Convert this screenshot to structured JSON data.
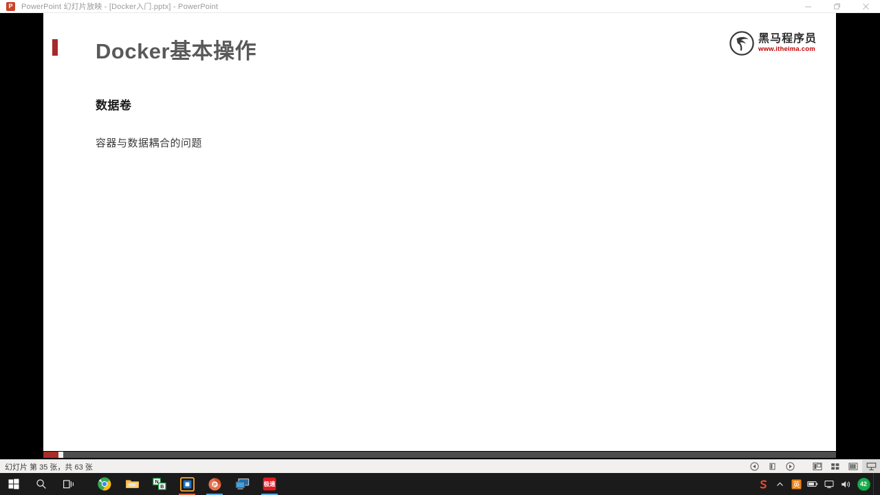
{
  "window": {
    "app_icon": "powerpoint-icon",
    "icon_letter": "P",
    "title": "PowerPoint 幻灯片放映 - [Docker入门.pptx] - PowerPoint",
    "controls": {
      "minimize": "minimize-icon",
      "restore": "restore-icon",
      "close": "close-icon"
    }
  },
  "slide": {
    "title": "Docker基本操作",
    "accent_color": "#a52a2a",
    "title_color": "#595959",
    "body": {
      "heading": "数据卷",
      "line": "容器与数据耦合的问题"
    },
    "logo": {
      "name_cn": "黑马程序员",
      "url": "www.itheima.com",
      "url_color": "#c00000"
    }
  },
  "progress": {
    "percent": 2,
    "fill_color": "#a82c28",
    "track_color": "#4d4d4d"
  },
  "statusbar": {
    "text": "幻灯片 第 35 张，共 63 张",
    "buttons": [
      {
        "name": "previous-slide-button",
        "label": "上一张"
      },
      {
        "name": "pause-button",
        "label": "暂停"
      },
      {
        "name": "next-slide-button",
        "label": "下一张"
      },
      {
        "name": "normal-view-button",
        "label": "普通视图"
      },
      {
        "name": "slide-sorter-button",
        "label": "幻灯片浏览"
      },
      {
        "name": "reading-view-button",
        "label": "阅读视图"
      },
      {
        "name": "slideshow-button",
        "label": "幻灯片放映"
      }
    ],
    "active_view": "slideshow-button"
  },
  "taskbar": {
    "items": [
      {
        "name": "start-button",
        "label": "开始"
      },
      {
        "name": "search-button",
        "label": "搜索"
      },
      {
        "name": "task-view-button",
        "label": "任务视图"
      },
      {
        "name": "chrome-taskbar-icon",
        "label": "Google Chrome"
      },
      {
        "name": "file-explorer-taskbar-icon",
        "label": "文件资源管理器"
      },
      {
        "name": "nb-app-taskbar-icon",
        "label": "NB"
      },
      {
        "name": "vmware-taskbar-icon",
        "label": "VMware"
      },
      {
        "name": "powerpoint-taskbar-icon",
        "label": "PowerPoint"
      },
      {
        "name": "remote-desktop-taskbar-icon",
        "label": "远程桌面"
      },
      {
        "name": "red-app-taskbar-icon",
        "label": "极速"
      }
    ],
    "red_icon_text": "极速",
    "tray": [
      {
        "name": "sogou-input-tray-icon",
        "label": "S"
      },
      {
        "name": "show-hidden-icons-chevron-icon",
        "label": "︿"
      },
      {
        "name": "ime-tray-icon",
        "label": "英"
      },
      {
        "name": "battery-tray-icon",
        "label": "电池"
      },
      {
        "name": "network-tray-icon",
        "label": "网络"
      },
      {
        "name": "volume-tray-icon",
        "label": "音量"
      },
      {
        "name": "notification-badge",
        "label": "42"
      }
    ],
    "badge_count": "42"
  }
}
